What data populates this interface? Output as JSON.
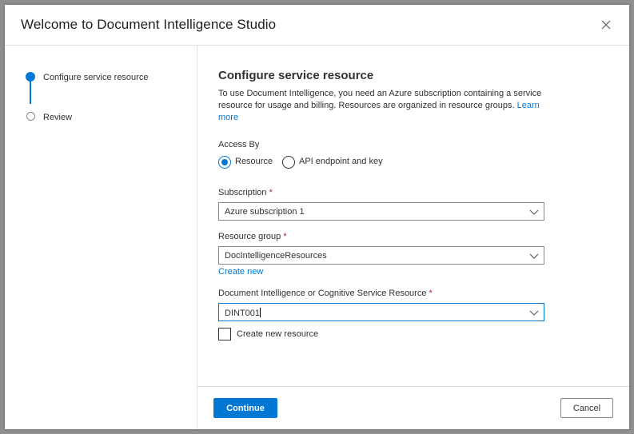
{
  "dialog": {
    "title": "Welcome to Document Intelligence Studio",
    "close_icon": "close-icon"
  },
  "steps": [
    {
      "label": "Configure service resource",
      "state": "active"
    },
    {
      "label": "Review",
      "state": "inactive"
    }
  ],
  "section": {
    "title": "Configure service resource",
    "description": "To use Document Intelligence, you need an Azure subscription containing a service resource for usage and billing. Resources are organized in resource groups.",
    "learn_more": "Learn more"
  },
  "access_by": {
    "label": "Access By",
    "options": [
      {
        "label": "Resource",
        "selected": true
      },
      {
        "label": "API endpoint and key",
        "selected": false
      }
    ]
  },
  "subscription": {
    "label": "Subscription",
    "required_mark": "*",
    "value": "Azure subscription 1"
  },
  "resource_group": {
    "label": "Resource group",
    "required_mark": "*",
    "value": "DocIntelligenceResources",
    "create_new": "Create new"
  },
  "resource": {
    "label": "Document Intelligence or Cognitive Service Resource",
    "required_mark": "*",
    "value": "DINT001"
  },
  "create_new_resource": {
    "label": "Create new resource",
    "checked": false
  },
  "footer": {
    "continue_label": "Continue",
    "cancel_label": "Cancel"
  },
  "colors": {
    "accent": "#0078d4",
    "required": "#a4262c"
  }
}
